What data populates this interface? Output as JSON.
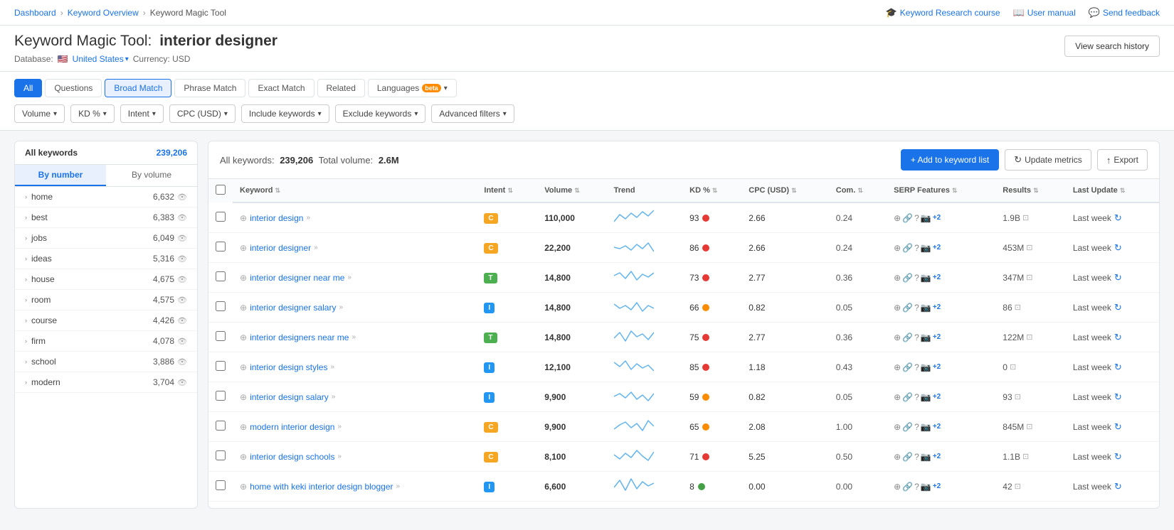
{
  "breadcrumb": {
    "items": [
      "Dashboard",
      "Keyword Overview",
      "Keyword Magic Tool"
    ]
  },
  "topLinks": {
    "course": "Keyword Research course",
    "manual": "User manual",
    "feedback": "Send feedback",
    "history": "View search history"
  },
  "header": {
    "title_prefix": "Keyword Magic Tool:",
    "query": "interior designer",
    "database_label": "Database:",
    "country": "United States",
    "currency": "Currency: USD"
  },
  "tabs": [
    {
      "id": "all",
      "label": "All",
      "active": true
    },
    {
      "id": "questions",
      "label": "Questions"
    },
    {
      "id": "broad",
      "label": "Broad Match",
      "activeOutline": true
    },
    {
      "id": "phrase",
      "label": "Phrase Match"
    },
    {
      "id": "exact",
      "label": "Exact Match"
    },
    {
      "id": "related",
      "label": "Related"
    },
    {
      "id": "languages",
      "label": "Languages",
      "hasBeta": true
    }
  ],
  "filters": [
    {
      "id": "volume",
      "label": "Volume",
      "hasChevron": true
    },
    {
      "id": "kd",
      "label": "KD %",
      "hasChevron": true
    },
    {
      "id": "intent",
      "label": "Intent",
      "hasChevron": true
    },
    {
      "id": "cpc",
      "label": "CPC (USD)",
      "hasChevron": true
    },
    {
      "id": "include",
      "label": "Include keywords",
      "hasChevron": true
    },
    {
      "id": "exclude",
      "label": "Exclude keywords",
      "hasChevron": true
    },
    {
      "id": "advanced",
      "label": "Advanced filters",
      "hasChevron": true
    }
  ],
  "sortButtons": [
    {
      "id": "by-number",
      "label": "By number",
      "active": true
    },
    {
      "id": "by-volume",
      "label": "By volume"
    }
  ],
  "sidebar": {
    "header": "All keywords",
    "count": "239,206",
    "items": [
      {
        "label": "home",
        "count": "6,632"
      },
      {
        "label": "best",
        "count": "6,383"
      },
      {
        "label": "jobs",
        "count": "6,049"
      },
      {
        "label": "ideas",
        "count": "5,316"
      },
      {
        "label": "house",
        "count": "4,675"
      },
      {
        "label": "room",
        "count": "4,575"
      },
      {
        "label": "course",
        "count": "4,426"
      },
      {
        "label": "firm",
        "count": "4,078"
      },
      {
        "label": "school",
        "count": "3,886"
      },
      {
        "label": "modern",
        "count": "3,704"
      }
    ]
  },
  "tableSummary": {
    "label_all": "All keywords:",
    "count": "239,206",
    "label_volume": "Total volume:",
    "volume": "2.6M"
  },
  "tableActions": {
    "add": "+ Add to keyword list",
    "update": "Update metrics",
    "export": "Export"
  },
  "tableColumns": [
    "",
    "Keyword",
    "Intent",
    "Volume",
    "Trend",
    "KD %",
    "CPC (USD)",
    "Com.",
    "SERP Features",
    "Results",
    "Last Update"
  ],
  "tableRows": [
    {
      "keyword": "interior design",
      "intent": "C",
      "intentClass": "intent-c",
      "volume": "110,000",
      "kd": 93,
      "kdColor": "kd-red",
      "cpc": "2.66",
      "com": "0.24",
      "results": "1.9B",
      "lastUpdate": "Last week",
      "trendPoints": "0,18 8,8 16,14 24,6 32,12 40,4 48,10 56,2"
    },
    {
      "keyword": "interior designer",
      "intent": "C",
      "intentClass": "intent-c",
      "volume": "22,200",
      "kd": 86,
      "kdColor": "kd-red",
      "cpc": "2.66",
      "com": "0.24",
      "results": "453M",
      "lastUpdate": "Last week",
      "trendPoints": "0,12 8,14 16,10 24,16 32,8 40,14 48,6 56,18"
    },
    {
      "keyword": "interior designer near me",
      "intent": "T",
      "intentClass": "intent-t",
      "volume": "14,800",
      "kd": 73,
      "kdColor": "kd-red",
      "cpc": "2.77",
      "com": "0.36",
      "results": "347M",
      "lastUpdate": "Last week",
      "trendPoints": "0,10 8,6 16,14 24,4 32,16 40,8 48,12 56,6"
    },
    {
      "keyword": "interior designer salary",
      "intent": "I",
      "intentClass": "intent-i",
      "volume": "14,800",
      "kd": 66,
      "kdColor": "kd-orange",
      "cpc": "0.82",
      "com": "0.05",
      "results": "86",
      "lastUpdate": "Last week",
      "trendPoints": "0,8 8,14 16,10 24,16 32,6 40,18 48,10 56,14"
    },
    {
      "keyword": "interior designers near me",
      "intent": "T",
      "intentClass": "intent-t",
      "volume": "14,800",
      "kd": 75,
      "kdColor": "kd-red",
      "cpc": "2.77",
      "com": "0.36",
      "results": "122M",
      "lastUpdate": "Last week",
      "trendPoints": "0,14 8,6 16,18 24,4 32,12 40,8 48,16 56,6"
    },
    {
      "keyword": "interior design styles",
      "intent": "I",
      "intentClass": "intent-i",
      "volume": "12,100",
      "kd": 85,
      "kdColor": "kd-red",
      "cpc": "1.18",
      "com": "0.43",
      "results": "0",
      "lastUpdate": "Last week",
      "trendPoints": "0,6 8,12 16,4 24,16 32,8 40,14 48,10 56,18"
    },
    {
      "keyword": "interior design salary",
      "intent": "I",
      "intentClass": "intent-i",
      "volume": "9,900",
      "kd": 59,
      "kdColor": "kd-orange",
      "cpc": "0.82",
      "com": "0.05",
      "results": "93",
      "lastUpdate": "Last week",
      "trendPoints": "0,12 8,8 16,14 24,6 32,16 40,10 48,18 56,8"
    },
    {
      "keyword": "modern interior design",
      "intent": "C",
      "intentClass": "intent-c",
      "volume": "9,900",
      "kd": 65,
      "kdColor": "kd-orange",
      "cpc": "2.08",
      "com": "1.00",
      "results": "845M",
      "lastUpdate": "Last week",
      "trendPoints": "0,16 8,10 16,6 24,14 32,8 40,18 48,4 56,12"
    },
    {
      "keyword": "interior design schools",
      "intent": "C",
      "intentClass": "intent-c",
      "volume": "8,100",
      "kd": 71,
      "kdColor": "kd-red",
      "cpc": "5.25",
      "com": "0.50",
      "results": "1.1B",
      "lastUpdate": "Last week",
      "trendPoints": "0,10 8,16 16,8 24,14 32,4 40,12 48,18 56,6"
    },
    {
      "keyword": "home with keki interior design blogger",
      "intent": "I",
      "intentClass": "intent-i",
      "volume": "6,600",
      "kd": 8,
      "kdColor": "kd-green",
      "cpc": "0.00",
      "com": "0.00",
      "results": "42",
      "lastUpdate": "Last week",
      "trendPoints": "0,14 8,4 16,18 24,2 32,16 40,6 48,12 56,8"
    }
  ]
}
